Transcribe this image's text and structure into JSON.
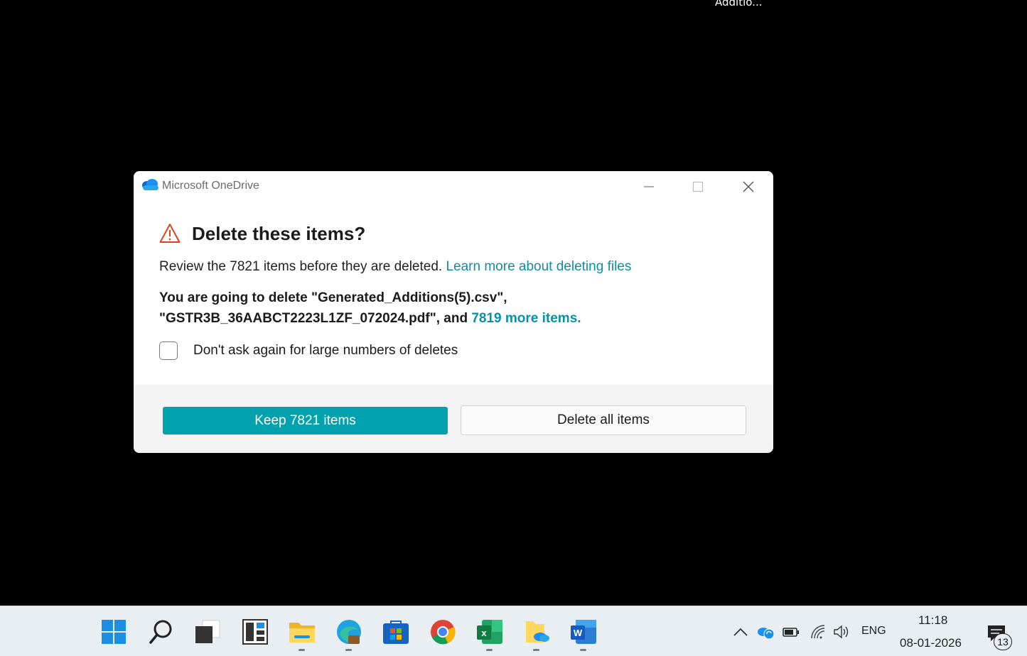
{
  "desktop": {
    "label": "Additio..."
  },
  "dialog": {
    "app_title": "Microsoft OneDrive",
    "heading": "Delete these items?",
    "review_text": "Review the 7821 items before they are deleted. ",
    "learn_more_link": "Learn more about deleting files",
    "going_line1": "You are going to delete \"Generated_Additions(5).csv\",",
    "going_line2": "\"GSTR3B_36AABCT2223L1ZF_072024.pdf\", and ",
    "more_items_link": "7819 more items.",
    "checkbox_label": "Don't ask again for large numbers of deletes",
    "checkbox_checked": false,
    "keep_button": "Keep 7821 items",
    "delete_button": "Delete all items",
    "colors": {
      "accent": "#01a1ae",
      "link": "#0b8fa8",
      "warning": "#d9431e"
    }
  },
  "taskbar": {
    "apps": [
      "start-icon",
      "search-icon",
      "task-view-icon",
      "widgets-icon",
      "file-explorer-icon",
      "edge-icon",
      "store-icon",
      "chrome-icon",
      "excel-icon",
      "onedrive-folder-icon",
      "word-icon"
    ],
    "language": "ENG",
    "time": "11:18",
    "date": "08-01-2026",
    "notification_count": "13"
  }
}
